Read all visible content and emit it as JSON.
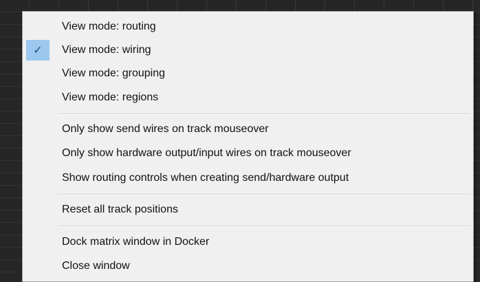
{
  "menu": {
    "items": [
      {
        "label": "View mode: routing",
        "checked": false
      },
      {
        "label": "View mode: wiring",
        "checked": true
      },
      {
        "label": "View mode: grouping",
        "checked": false
      },
      {
        "label": "View mode: regions",
        "checked": false
      },
      {
        "label": "Only show send wires on track mouseover",
        "checked": false
      },
      {
        "label": "Only show hardware output/input wires on track mouseover",
        "checked": false
      },
      {
        "label": "Show routing controls when creating send/hardware output",
        "checked": false
      },
      {
        "label": "Reset all track positions",
        "checked": false
      },
      {
        "label": "Dock matrix window in Docker",
        "checked": false
      },
      {
        "label": "Close window",
        "checked": false
      }
    ],
    "check_glyph": "✓"
  }
}
